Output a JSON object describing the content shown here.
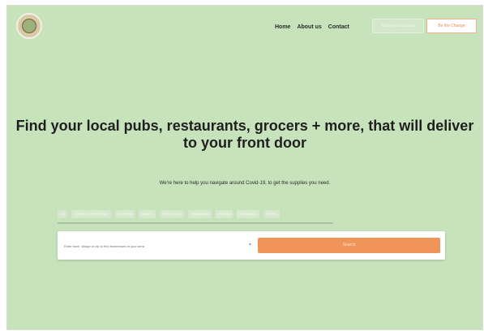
{
  "nav": {
    "items": [
      "Home",
      "About us",
      "Contact"
    ],
    "secondary_button_label": "Add your business",
    "primary_button_label": "Be the Change"
  },
  "hero": {
    "title": "Find your local pubs, restaurants, grocers + more, that will deliver to your front door",
    "subtitle": "We're here to help you navigate around Covid-19, to get the supplies you need."
  },
  "filters": {
    "labels": [
      "All",
      "Grocers & Farm Shops",
      "Butchers",
      "Bakers",
      "Pubs & Bars",
      "Restaurants",
      "Florists",
      "Takeaways",
      "Others"
    ]
  },
  "search": {
    "placeholder": "Enter town, village or zip to find businesses in your area",
    "button_label": "Search"
  },
  "colors": {
    "page_background": "#c7e3bb",
    "accent": "#f0955a"
  },
  "icons": [
    "logo-icon",
    "chevron-down-icon"
  ]
}
